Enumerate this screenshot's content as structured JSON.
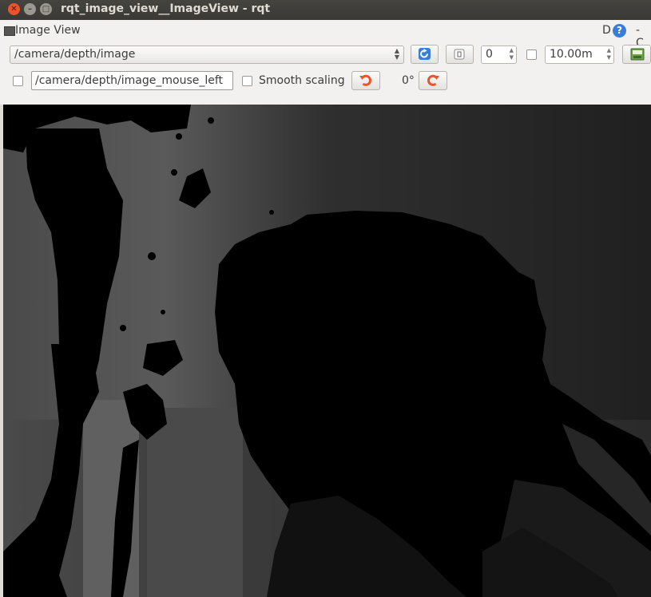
{
  "window": {
    "title": "rqt_image_view__ImageView - rqt"
  },
  "dock": {
    "title": "Image View",
    "right_label": "D",
    "help_icon": "?",
    "right_label2": "- C"
  },
  "toolbar": {
    "topic": "/camera/depth/image",
    "spin_value": "0",
    "max_range": "10.00m",
    "mouse_topic": "/camera/depth/image_mouse_left",
    "smooth_scaling_label": "Smooth scaling",
    "rotation": "0°"
  },
  "colors": {
    "accent_orange": "#e8552d",
    "refresh_blue": "#3a7dd8",
    "panel": "#f2f1f0"
  }
}
